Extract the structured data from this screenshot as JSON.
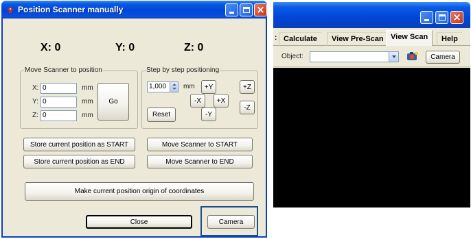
{
  "dialog": {
    "title": "Position Scanner manually",
    "coords": {
      "x_label": "X: 0",
      "y_label": "Y: 0",
      "z_label": "Z: 0"
    },
    "move_group": {
      "label": "Move Scanner to position",
      "x": {
        "label": "X:",
        "value": "0",
        "unit": "mm"
      },
      "y": {
        "label": "Y:",
        "value": "0",
        "unit": "mm"
      },
      "z": {
        "label": "Z:",
        "value": "0",
        "unit": "mm"
      },
      "go_label": "Go"
    },
    "step_group": {
      "label": "Step by step positioning",
      "step_value": "1,000",
      "step_unit": "mm",
      "plus_y": "+Y",
      "minus_y": "-Y",
      "minus_x": "-X",
      "plus_x": "+X",
      "plus_z": "+Z",
      "minus_z": "-Z",
      "reset_label": "Reset"
    },
    "store_start_label": "Store current position as START",
    "store_end_label": "Store current position as END",
    "move_start_label": "Move Scanner to START",
    "move_end_label": "Move Scanner to END",
    "origin_label": "Make current position origin of coordinates",
    "close_label": "Close",
    "camera_label": "Camera"
  },
  "right_window": {
    "tabs": [
      {
        "label": "Calculate"
      },
      {
        "label": "View Pre-Scan"
      },
      {
        "label": "View Scan"
      },
      {
        "label": "Help"
      }
    ],
    "object_label": "Object:",
    "object_value": "",
    "camera_label": "Camera"
  },
  "colors": {
    "titlebar_blue": "#0046d8",
    "dialog_bg": "#ece9d8",
    "camera_highlight": "#1c4e8c",
    "scan_area": "#000000"
  }
}
